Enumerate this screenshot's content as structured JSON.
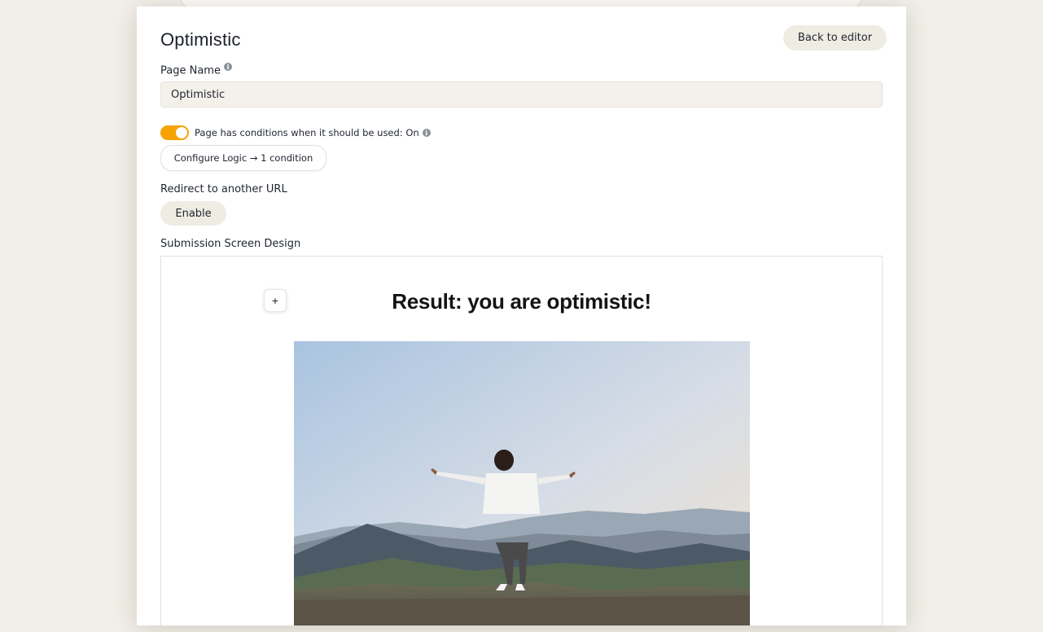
{
  "page": {
    "title": "Optimistic",
    "back_label": "Back to editor"
  },
  "page_name": {
    "label": "Page Name",
    "value": "Optimistic"
  },
  "conditions": {
    "toggle_on": true,
    "text": "Page has conditions when it should be used: On",
    "configure_label": "Configure Logic → 1 condition"
  },
  "redirect": {
    "label": "Redirect to another URL",
    "enable_label": "Enable"
  },
  "design": {
    "label": "Submission Screen Design",
    "add_label": "+",
    "heading": "Result: you are optimistic!"
  },
  "colors": {
    "accent": "#f5a300",
    "panel": "#ffffff",
    "background": "#f1efe8"
  },
  "icons": {
    "info": "info-icon",
    "add": "plus-icon"
  }
}
